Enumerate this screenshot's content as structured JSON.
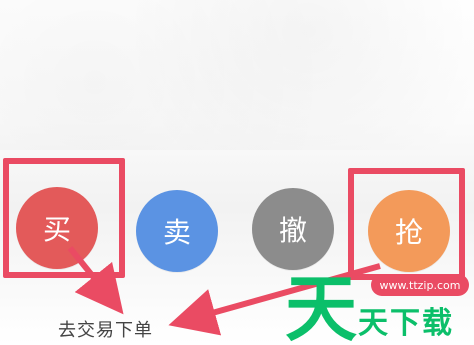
{
  "buttons": {
    "buy": {
      "label": "买",
      "color": "#e35a5a"
    },
    "sell": {
      "label": "卖",
      "color": "#5b93e3"
    },
    "cancel": {
      "label": "撤",
      "color": "#8c8c8c"
    },
    "grab": {
      "label": "抢",
      "color": "#f39a5a"
    }
  },
  "annotation": {
    "caption": "去交易下单",
    "highlight_color": "#ea4b63"
  },
  "watermark": {
    "url": "www.ttzip.com",
    "text": "天下载",
    "logo_char": "天",
    "brand_color": "#0bbf6a"
  }
}
